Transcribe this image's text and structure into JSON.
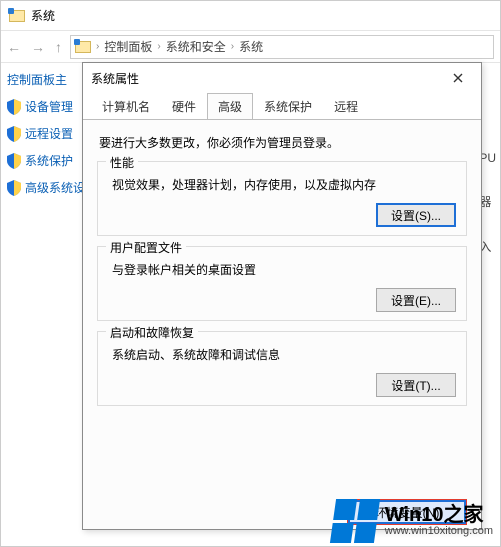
{
  "window": {
    "title": "系统",
    "breadcrumbs": [
      "控制面板",
      "系统和安全",
      "系统"
    ]
  },
  "sidebar": {
    "heading": "控制面板主",
    "items": [
      {
        "label": "设备管理"
      },
      {
        "label": "远程设置"
      },
      {
        "label": "系统保护"
      },
      {
        "label": "高级系统设"
      }
    ]
  },
  "right_fragments": [
    "PU",
    "器",
    "入"
  ],
  "dialog": {
    "title": "系统属性",
    "tabs": [
      {
        "label": "计算机名",
        "active": false
      },
      {
        "label": "硬件",
        "active": false
      },
      {
        "label": "高级",
        "active": true
      },
      {
        "label": "系统保护",
        "active": false
      },
      {
        "label": "远程",
        "active": false
      }
    ],
    "admin_note": "要进行大多数更改，你必须作为管理员登录。",
    "groups": [
      {
        "title": "性能",
        "desc": "视觉效果，处理器计划，内存使用，以及虚拟内存",
        "button": "设置(S)..."
      },
      {
        "title": "用户配置文件",
        "desc": "与登录帐户相关的桌面设置",
        "button": "设置(E)..."
      },
      {
        "title": "启动和故障恢复",
        "desc": "系统启动、系统故障和调试信息",
        "button": "设置(T)..."
      }
    ],
    "env_button": "环境变量(N)"
  },
  "watermark": {
    "big": "Win10之家",
    "small": "www.win10xitong.com"
  }
}
